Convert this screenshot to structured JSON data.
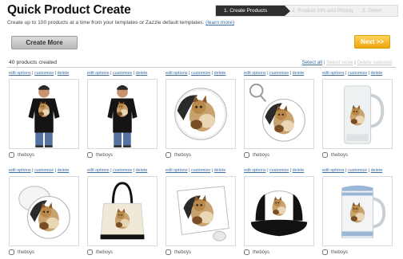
{
  "header": {
    "title": "Quick Product Create",
    "subtitle": "Create up to 100 products at a time from your templates or Zazzle default templates.",
    "learn_more": "(learn more)"
  },
  "steps": [
    {
      "label": "1. Create Products",
      "active": true
    },
    {
      "label": "2. Product Info and Pricing",
      "active": false
    },
    {
      "label": "3. Done!",
      "active": false
    }
  ],
  "toolbar": {
    "create_more": "Create More",
    "next": "Next >>"
  },
  "summary": {
    "count_text": "40 products created",
    "select_all": "Select all",
    "select_none": "Select none",
    "delete_selected": "Delete selected",
    "separator": "|"
  },
  "card_links": {
    "edit": "edit options",
    "customize": "customize",
    "delete": "delete",
    "sep": "|"
  },
  "products": [
    {
      "type": "tshirt-front",
      "label": "theboys"
    },
    {
      "type": "tshirt-side",
      "label": "theboys"
    },
    {
      "type": "button-large",
      "label": "theboys"
    },
    {
      "type": "keychain",
      "label": "theboys"
    },
    {
      "type": "glass-mug",
      "label": "theboys"
    },
    {
      "type": "button-angled",
      "label": "theboys"
    },
    {
      "type": "tote-bag",
      "label": "theboys"
    },
    {
      "type": "mousepad",
      "label": "theboys"
    },
    {
      "type": "trucker-hat",
      "label": "theboys"
    },
    {
      "type": "beer-stein",
      "label": "theboys"
    }
  ]
}
